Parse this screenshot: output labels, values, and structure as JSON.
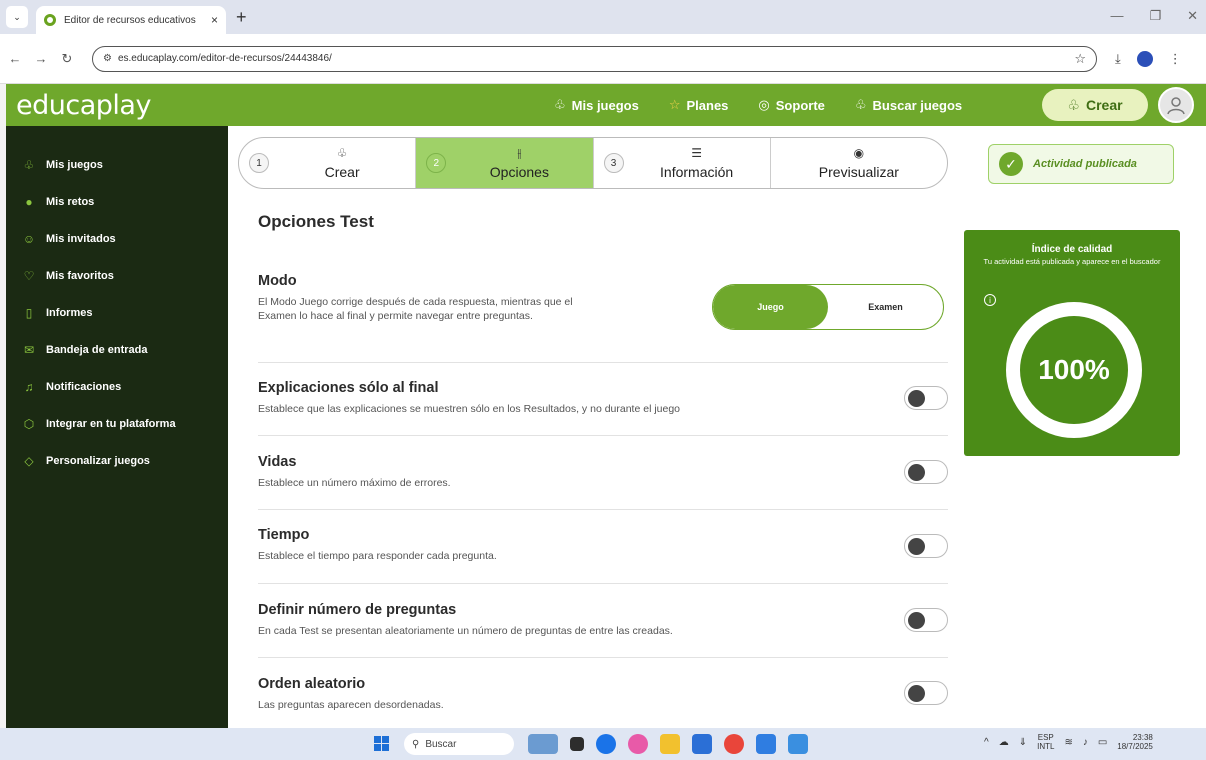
{
  "browser": {
    "tab_title": "Editor de recursos educativos",
    "tab_close": "×",
    "new_tab": "+",
    "url": "es.educaplay.com/editor-de-recursos/24443846/"
  },
  "header": {
    "logo": "educaplay",
    "nav": [
      {
        "label": "Mis juegos",
        "icon": "games-icon"
      },
      {
        "label": "Planes",
        "icon": "star-icon"
      },
      {
        "label": "Soporte",
        "icon": "support-icon"
      },
      {
        "label": "Buscar juegos",
        "icon": "search-games-icon"
      }
    ],
    "create_label": "Crear"
  },
  "sidebar": {
    "items": [
      {
        "label": "Mis juegos",
        "icon": "games-icon"
      },
      {
        "label": "Mis retos",
        "icon": "challenge-icon"
      },
      {
        "label": "Mis invitados",
        "icon": "guests-icon"
      },
      {
        "label": "Mis favoritos",
        "icon": "heart-icon"
      },
      {
        "label": "Informes",
        "icon": "report-icon"
      },
      {
        "label": "Bandeja de entrada",
        "icon": "inbox-icon"
      },
      {
        "label": "Notificaciones",
        "icon": "bell-icon"
      },
      {
        "label": "Integrar en tu plataforma",
        "icon": "integrate-icon"
      },
      {
        "label": "Personalizar juegos",
        "icon": "customize-icon"
      }
    ]
  },
  "stepper": {
    "steps": [
      {
        "num": "1",
        "label": "Crear",
        "icon": "create-icon"
      },
      {
        "num": "2",
        "label": "Opciones",
        "icon": "sliders-icon"
      },
      {
        "num": "3",
        "label": "Información",
        "icon": "list-icon"
      },
      {
        "num": "",
        "label": "Previsualizar",
        "icon": "eye-icon"
      }
    ],
    "active_index": 1
  },
  "status": {
    "published_label": "Actividad publicada"
  },
  "quality": {
    "title": "Índice de calidad",
    "subtitle": "Tu actividad está publicada y aparece en el buscador",
    "info": "i",
    "percent_label": "100%",
    "percent_value": 100
  },
  "options": {
    "title": "Opciones Test",
    "mode": {
      "title": "Modo",
      "desc": "El Modo Juego corrige después de cada respuesta, mientras que el Examen lo hace al final y permite navegar entre preguntas.",
      "options": [
        "Juego",
        "Examen"
      ],
      "selected": "Juego"
    },
    "toggles": [
      {
        "title": "Explicaciones sólo al final",
        "desc": "Establece que las explicaciones se muestren sólo en los Resultados, y no durante el juego",
        "on": false
      },
      {
        "title": "Vidas",
        "desc": "Establece un número máximo de errores.",
        "on": false
      },
      {
        "title": "Tiempo",
        "desc": "Establece el tiempo para responder cada pregunta.",
        "on": false
      },
      {
        "title": "Definir número de preguntas",
        "desc": "En cada Test se presentan aleatoriamente un número de preguntas de entre las creadas.",
        "on": false
      },
      {
        "title": "Orden aleatorio",
        "desc": "Las preguntas aparecen desordenadas.",
        "on": false
      }
    ]
  },
  "taskbar": {
    "search_placeholder": "Buscar",
    "lang_top": "ESP",
    "lang_bottom": "INTL",
    "time": "23:38",
    "date": "18/7/2025"
  },
  "colors": {
    "brand_green": "#6fa82c",
    "active_step": "#9fd168",
    "sidebar_bg": "#1b2a13",
    "quality_bg": "#4b8c17"
  }
}
